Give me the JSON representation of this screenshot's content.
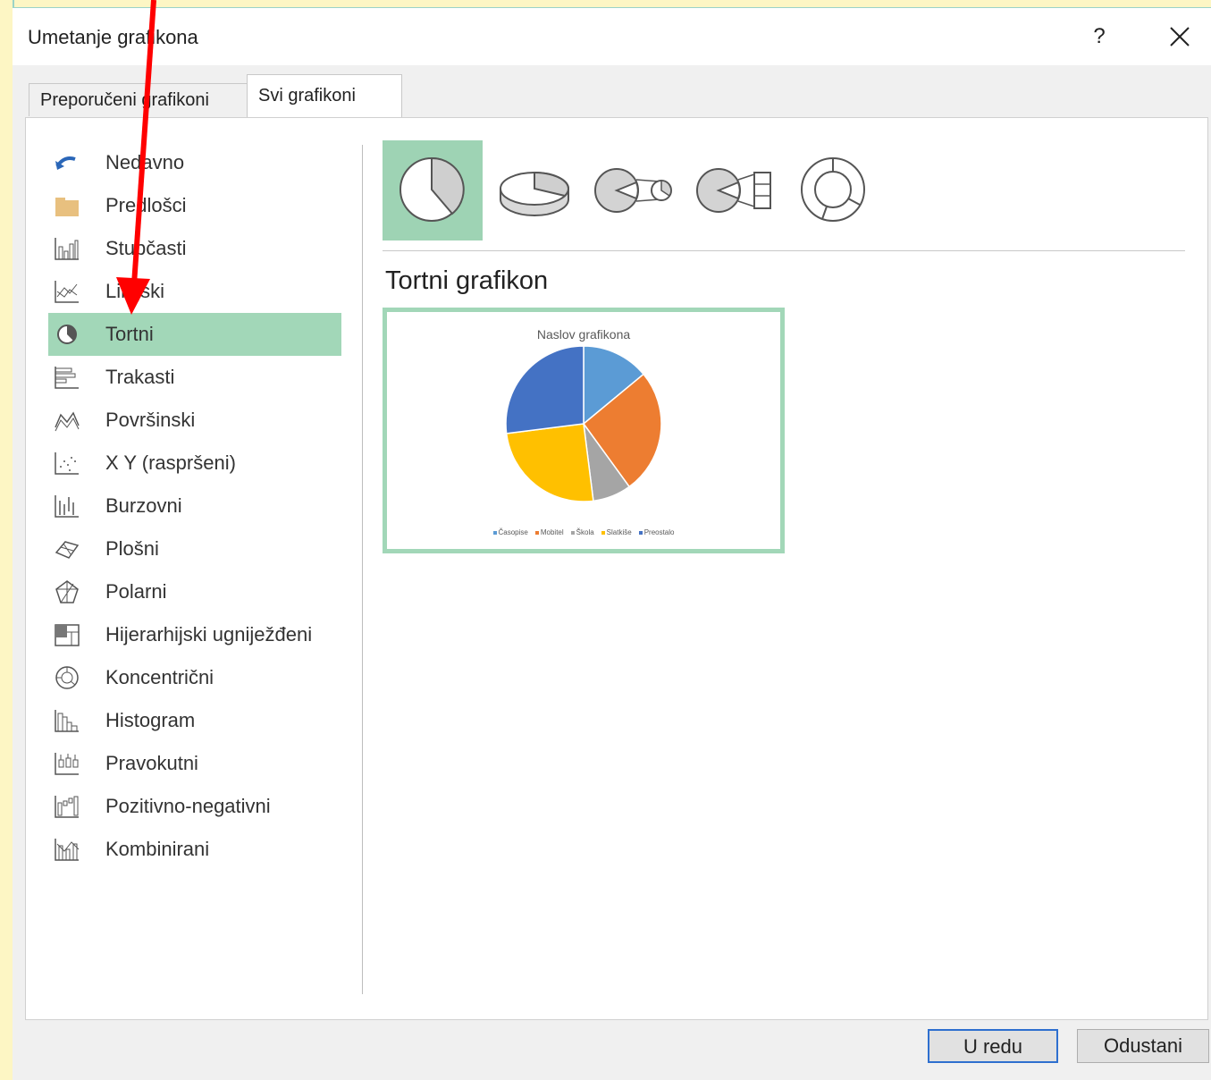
{
  "window": {
    "title": "Umetanje grafikona",
    "help_label": "?"
  },
  "tabs": [
    {
      "label": "Preporučeni grafikoni",
      "active": false
    },
    {
      "label": "Svi grafikoni",
      "active": true
    }
  ],
  "sidebar": {
    "items": [
      {
        "label": "Nedavno",
        "icon": "recent-icon"
      },
      {
        "label": "Predlošci",
        "icon": "folder-icon"
      },
      {
        "label": "Stupčasti",
        "icon": "column-chart-icon"
      },
      {
        "label": "Linijski",
        "icon": "line-chart-icon"
      },
      {
        "label": "Tortni",
        "icon": "pie-chart-icon",
        "active": true
      },
      {
        "label": "Trakasti",
        "icon": "bar-chart-icon"
      },
      {
        "label": "Površinski",
        "icon": "area-chart-icon"
      },
      {
        "label": "X Y (raspršeni)",
        "icon": "scatter-chart-icon"
      },
      {
        "label": "Burzovni",
        "icon": "stock-chart-icon"
      },
      {
        "label": "Plošni",
        "icon": "surface-chart-icon"
      },
      {
        "label": "Polarni",
        "icon": "radar-chart-icon"
      },
      {
        "label": "Hijerarhijski ugniježđeni",
        "icon": "treemap-chart-icon"
      },
      {
        "label": "Koncentrični",
        "icon": "sunburst-chart-icon"
      },
      {
        "label": "Histogram",
        "icon": "histogram-chart-icon"
      },
      {
        "label": "Pravokutni",
        "icon": "box-whisker-chart-icon"
      },
      {
        "label": "Pozitivno-negativni",
        "icon": "waterfall-chart-icon"
      },
      {
        "label": "Kombinirani",
        "icon": "combo-chart-icon"
      }
    ]
  },
  "chart_types": [
    "pie-icon",
    "3d-pie-icon",
    "pie-of-pie-icon",
    "bar-of-pie-icon",
    "doughnut-icon"
  ],
  "selected_type_title": "Tortni grafikon",
  "preview": {
    "chart_data": {
      "type": "pie",
      "title": "Naslov grafikona",
      "categories": [
        "Časopise",
        "Mobitel",
        "Škola",
        "Slatkiše",
        "Preostalo"
      ],
      "values": [
        14,
        26,
        8,
        25,
        27
      ],
      "colors": [
        "#5b9bd5",
        "#ed7d31",
        "#a5a5a5",
        "#ffc000",
        "#4472c4"
      ]
    }
  },
  "buttons": {
    "ok": "U redu",
    "cancel": "Odustani"
  },
  "colors": {
    "accent_selected": "#a2d7b8",
    "arrow": "#ff0000",
    "ok_border": "#2e6fcf"
  }
}
